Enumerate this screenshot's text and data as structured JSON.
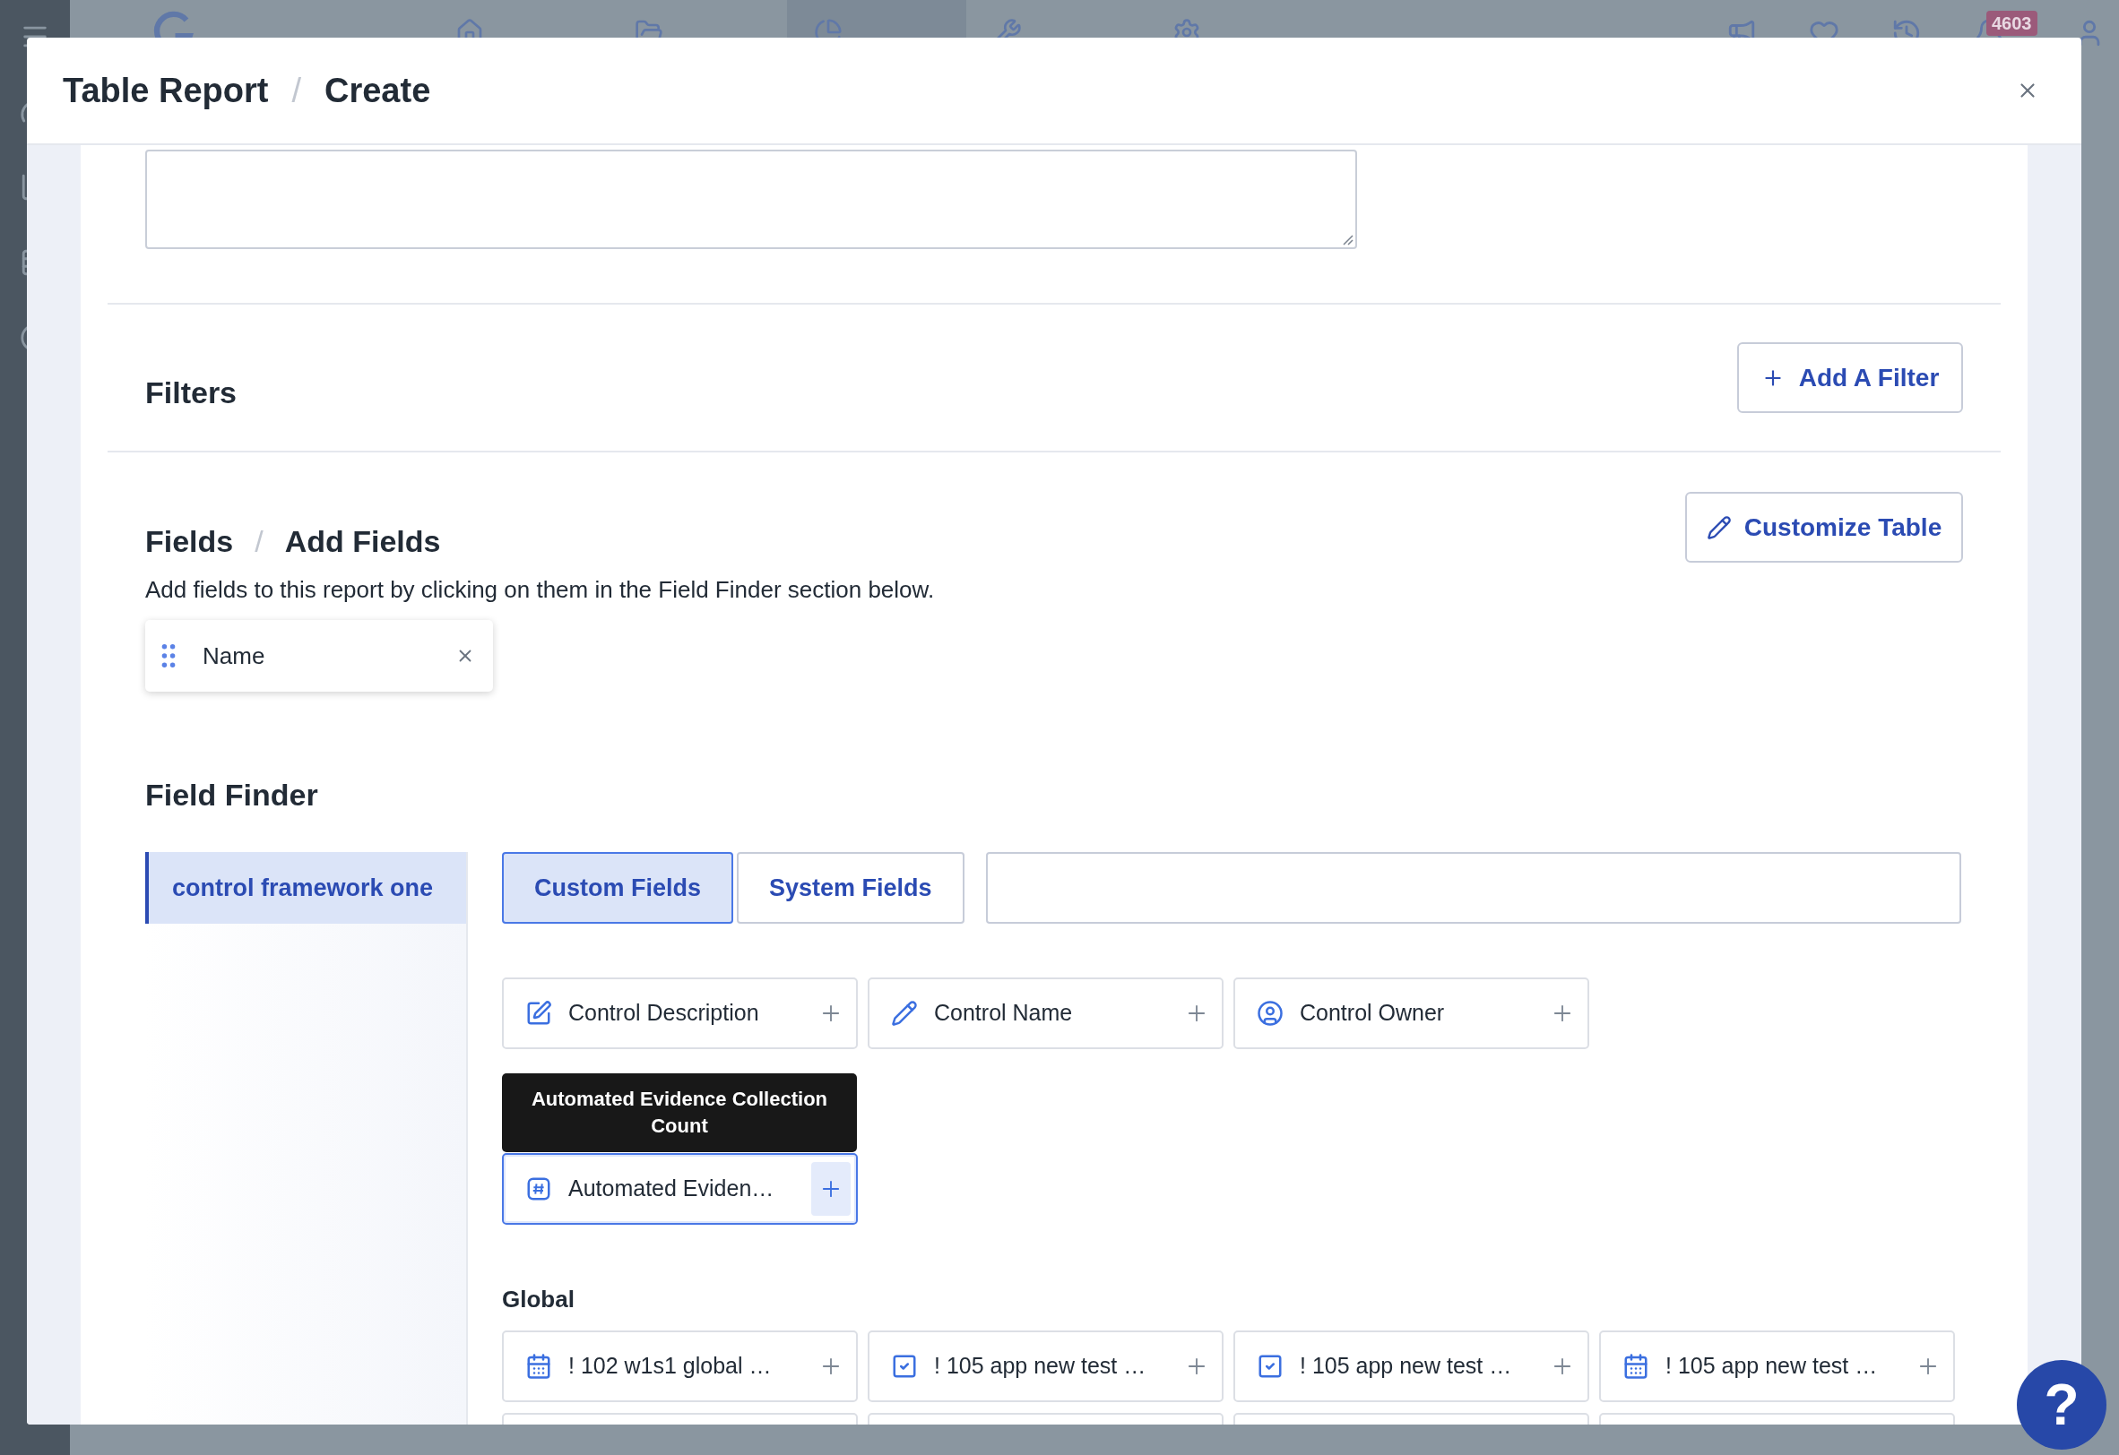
{
  "app_nav": {
    "items": [
      {
        "selected": false
      },
      {
        "selected": false
      },
      {
        "selected": true
      },
      {
        "selected": false
      },
      {
        "selected": false
      }
    ],
    "notification_count": "4603"
  },
  "modal": {
    "breadcrumb": [
      "Table Report",
      "Create"
    ],
    "separator": "/",
    "filters": {
      "title": "Filters",
      "add_button": "Add A Filter"
    },
    "fields": {
      "breadcrumb": [
        "Fields",
        "Add Fields"
      ],
      "separator": "/",
      "customize_button": "Customize Table",
      "description": "Add fields to this report by clicking on them in the Field Finder section below.",
      "selected_fields": [
        {
          "label": "Name"
        }
      ]
    },
    "field_finder": {
      "title": "Field Finder",
      "frameworks": [
        {
          "label": "control framework one",
          "selected": true
        }
      ],
      "tabs": [
        {
          "label": "Custom Fields",
          "selected": true
        },
        {
          "label": "System Fields",
          "selected": false
        }
      ],
      "sections": [
        {
          "cards": [
            {
              "kind": "edit",
              "label": "Control Description",
              "highlighted": false
            },
            {
              "kind": "pencil",
              "label": "Control Name",
              "highlighted": false
            },
            {
              "kind": "user",
              "label": "Control Owner",
              "highlighted": false
            }
          ]
        },
        {
          "tooltip": "Automated Evidence Collection Count",
          "cards": [
            {
              "kind": "number",
              "label": "Automated Eviden…",
              "highlighted": true
            }
          ]
        },
        {
          "title": "Global",
          "cards": [
            {
              "kind": "date",
              "label": "! 102 w1s1 global …",
              "highlighted": false
            },
            {
              "kind": "checkbox",
              "label": "! 105 app new test …",
              "highlighted": false
            },
            {
              "kind": "checkbox",
              "label": "! 105 app new test …",
              "highlighted": false
            },
            {
              "kind": "date",
              "label": "! 105 app new test …",
              "highlighted": false
            },
            {
              "kind": "cut_off"
            },
            {
              "kind": "cut_off"
            },
            {
              "kind": "cut_off"
            },
            {
              "kind": "cut_off"
            }
          ]
        }
      ]
    }
  },
  "help_button": "?"
}
